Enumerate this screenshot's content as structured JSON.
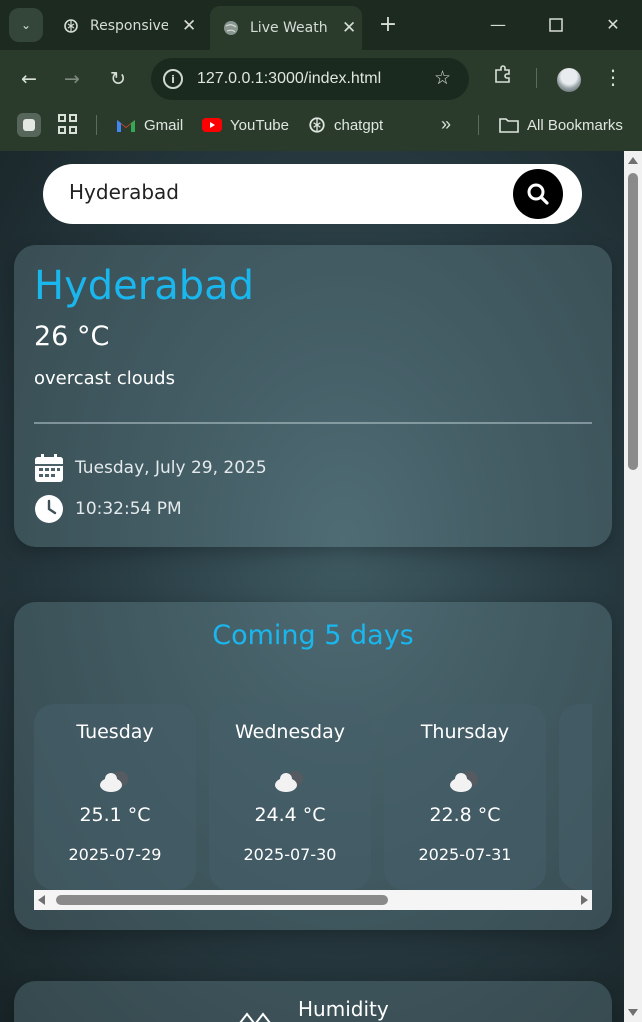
{
  "browser": {
    "tabs": [
      {
        "title": "Responsive",
        "active": false
      },
      {
        "title": "Live Weath",
        "active": true
      }
    ],
    "new_tab": "+",
    "url": "127.0.0.1:3000/index.html",
    "bookmarks": [
      {
        "label": "Gmail",
        "icon": "gmail-icon"
      },
      {
        "label": "YouTube",
        "icon": "youtube-icon"
      },
      {
        "label": "chatgpt",
        "icon": "chatgpt-icon"
      }
    ],
    "more": "»",
    "all_bookmarks": "All Bookmarks"
  },
  "search": {
    "value": "Hyderabad"
  },
  "current": {
    "city": "Hyderabad",
    "temperature": "26 °C",
    "condition": "overcast clouds",
    "date": "Tuesday, July 29, 2025",
    "time": "10:32:54 PM"
  },
  "forecast": {
    "title": "Coming 5 days",
    "days": [
      {
        "name": "Tuesday",
        "temp": "25.1 °C",
        "date": "2025-07-29"
      },
      {
        "name": "Wednesday",
        "temp": "24.4 °C",
        "date": "2025-07-30"
      },
      {
        "name": "Thursday",
        "temp": "22.8 °C",
        "date": "2025-07-31"
      },
      {
        "name": "",
        "temp": "",
        "date": ""
      }
    ]
  },
  "humidity": {
    "label": "Humidity"
  },
  "colors": {
    "accent": "#1ab7ef",
    "chrome": "#2a3b2c",
    "tabstrip": "#1d2a1f"
  }
}
